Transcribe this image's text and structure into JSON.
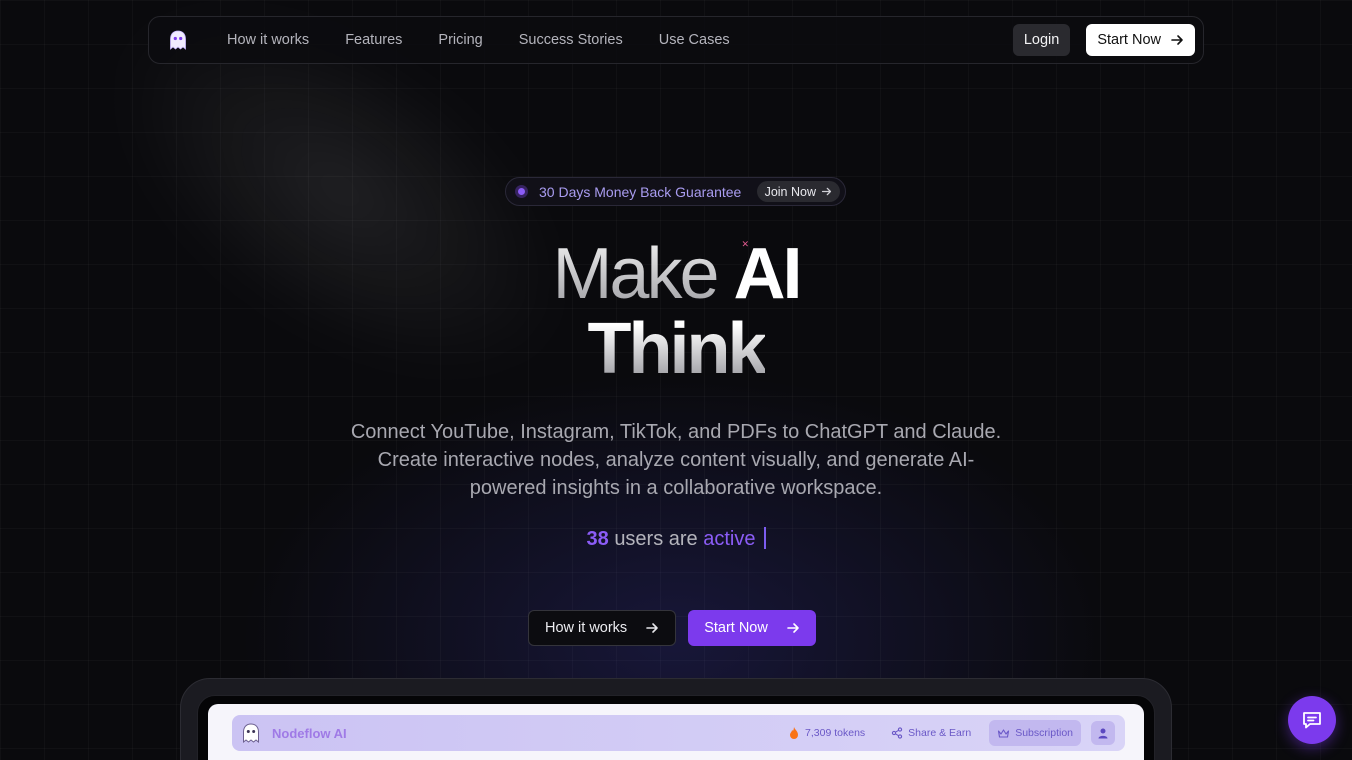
{
  "nav": {
    "links": [
      "How it works",
      "Features",
      "Pricing",
      "Success Stories",
      "Use Cases"
    ],
    "login_label": "Login",
    "start_label": "Start Now"
  },
  "badge": {
    "text": "30 Days Money Back Guarantee",
    "join_label": "Join Now"
  },
  "hero": {
    "make": "Make",
    "ai": "AI",
    "think": "Think",
    "subtitle": "Connect YouTube, Instagram, TikTok, and PDFs to ChatGPT and Claude. Create interactive nodes, analyze content visually, and generate AI-powered insights in a collaborative workspace.",
    "active_count": "38",
    "active_middle": "users are",
    "active_word": "active"
  },
  "cta": {
    "how_label": "How it works",
    "start_label": "Start Now"
  },
  "preview": {
    "app_name": "Nodeflow AI",
    "tokens": "7,309 tokens",
    "share": "Share & Earn",
    "subscription": "Subscription"
  },
  "colors": {
    "accent": "#7c3aed",
    "accent_light": "#8b5cf6",
    "background": "#0a0a0d"
  },
  "icons": {
    "logo": "ghost-icon",
    "arrow": "arrow-right-icon",
    "chat": "chat-icon",
    "flame": "flame-icon",
    "share": "share-icon",
    "crown": "crown-icon",
    "user": "user-icon"
  }
}
